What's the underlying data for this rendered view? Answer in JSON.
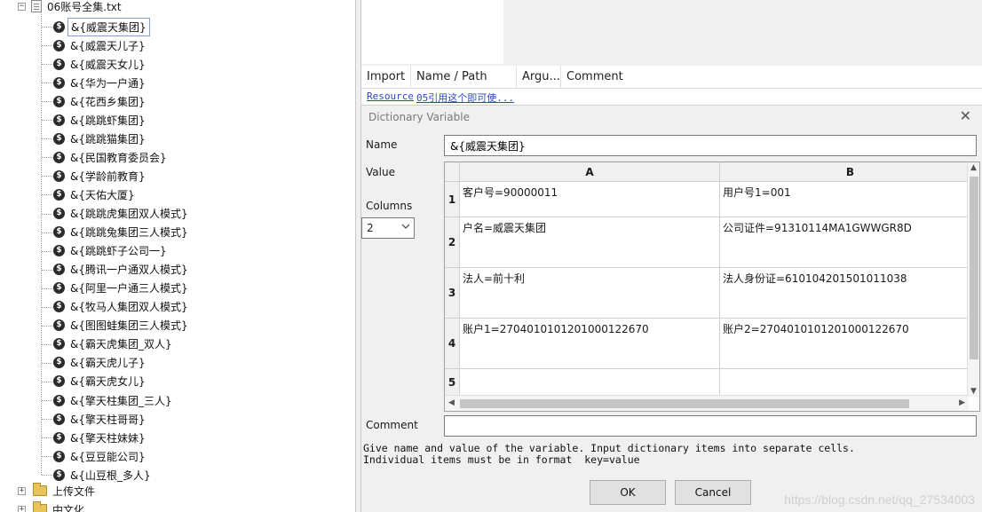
{
  "tree": {
    "root_file": "06账号全集.txt",
    "items": [
      "&{威震天集团}",
      "&{威震天儿子}",
      "&{威震天女儿}",
      "&{华为一户通}",
      "&{花西乡集团}",
      "&{跳跳虾集团}",
      "&{跳跳猫集团}",
      "&{民国教育委员会}",
      "&{学龄前教育}",
      "&{天佑大厦}",
      "&{跳跳虎集团双人模式}",
      "&{跳跳兔集团三人模式}",
      "&{跳跳虾子公司一}",
      "&{腾讯一户通双人模式}",
      "&{阿里一户通三人模式}",
      "&{牧马人集团双人模式}",
      "&{图图蛙集团三人模式}",
      "&{霸天虎集团_双人}",
      "&{霸天虎儿子}",
      "&{霸天虎女儿}",
      "&{擎天柱集团_三人}",
      "&{擎天柱哥哥}",
      "&{擎天柱妹妹}",
      "&{豆豆能公司}",
      "&{山豆根_多人}"
    ],
    "folders": [
      "上传文件",
      "中文化"
    ],
    "item_icon": "dollar-icon"
  },
  "settings_table": {
    "headers": [
      "Import",
      "Name / Path",
      "Argu...",
      "Comment"
    ],
    "row": {
      "import": "Resource",
      "path": "05引用这个即可使..."
    }
  },
  "dialog": {
    "title": "Dictionary Variable",
    "name_label": "Name",
    "name_value": "&{威震天集团}",
    "value_label": "Value",
    "columns_label": "Columns",
    "columns_value": "2",
    "grid": {
      "col_headers": [
        "A",
        "B"
      ],
      "row_numbers": [
        "1",
        "2",
        "3",
        "4",
        "5"
      ],
      "rows": [
        [
          "客户号=90000011",
          "用户号1=001"
        ],
        [
          "户名=威震天集团",
          "公司证件=91310114MA1GWWGR8D"
        ],
        [
          "法人=前十利",
          "法人身份证=610104201501011038"
        ],
        [
          "账户1=27040101012010001226​70",
          "账户2=27040101012010001226​70"
        ],
        [
          "",
          ""
        ]
      ]
    },
    "comment_label": "Comment",
    "help_line1": "Give name and value of the variable. Input dictionary items into separate cells.",
    "help_line2": "Individual items must be in format  key=value",
    "ok_label": "OK",
    "cancel_label": "Cancel",
    "close_icon": "close-icon"
  },
  "watermark": "https://blog.csdn.net/qq_27534003"
}
